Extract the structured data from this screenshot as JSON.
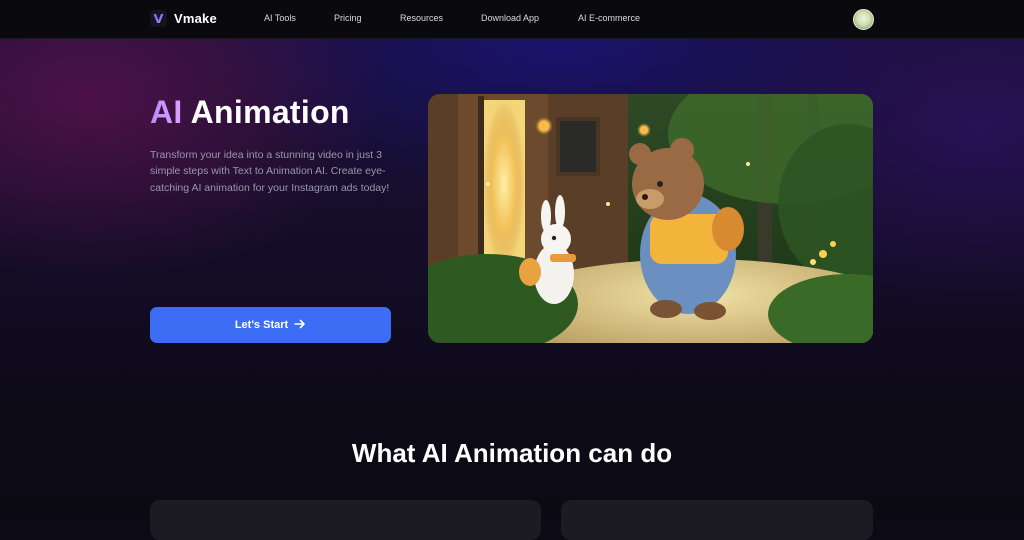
{
  "brand": {
    "name": "Vmake",
    "logo_icon": "vmake-logo-icon"
  },
  "nav": {
    "items": [
      {
        "label": "AI Tools"
      },
      {
        "label": "Pricing"
      },
      {
        "label": "Resources"
      },
      {
        "label": "Download App"
      },
      {
        "label": "AI E-commerce"
      }
    ],
    "avatar_icon": "user-avatar"
  },
  "hero": {
    "title_accent": "AI",
    "title_rest": "Animation",
    "description": "Transform your idea into a stunning video in just 3 simple steps with Text to Animation AI. Create eye-catching AI animation for your Instagram ads today!",
    "cta_label": "Let's Start",
    "cta_icon": "arrow-right-icon",
    "cta_color": "#3d6cf5",
    "accent_color": "#b58cff"
  },
  "section": {
    "title": "What AI Animation can do"
  }
}
